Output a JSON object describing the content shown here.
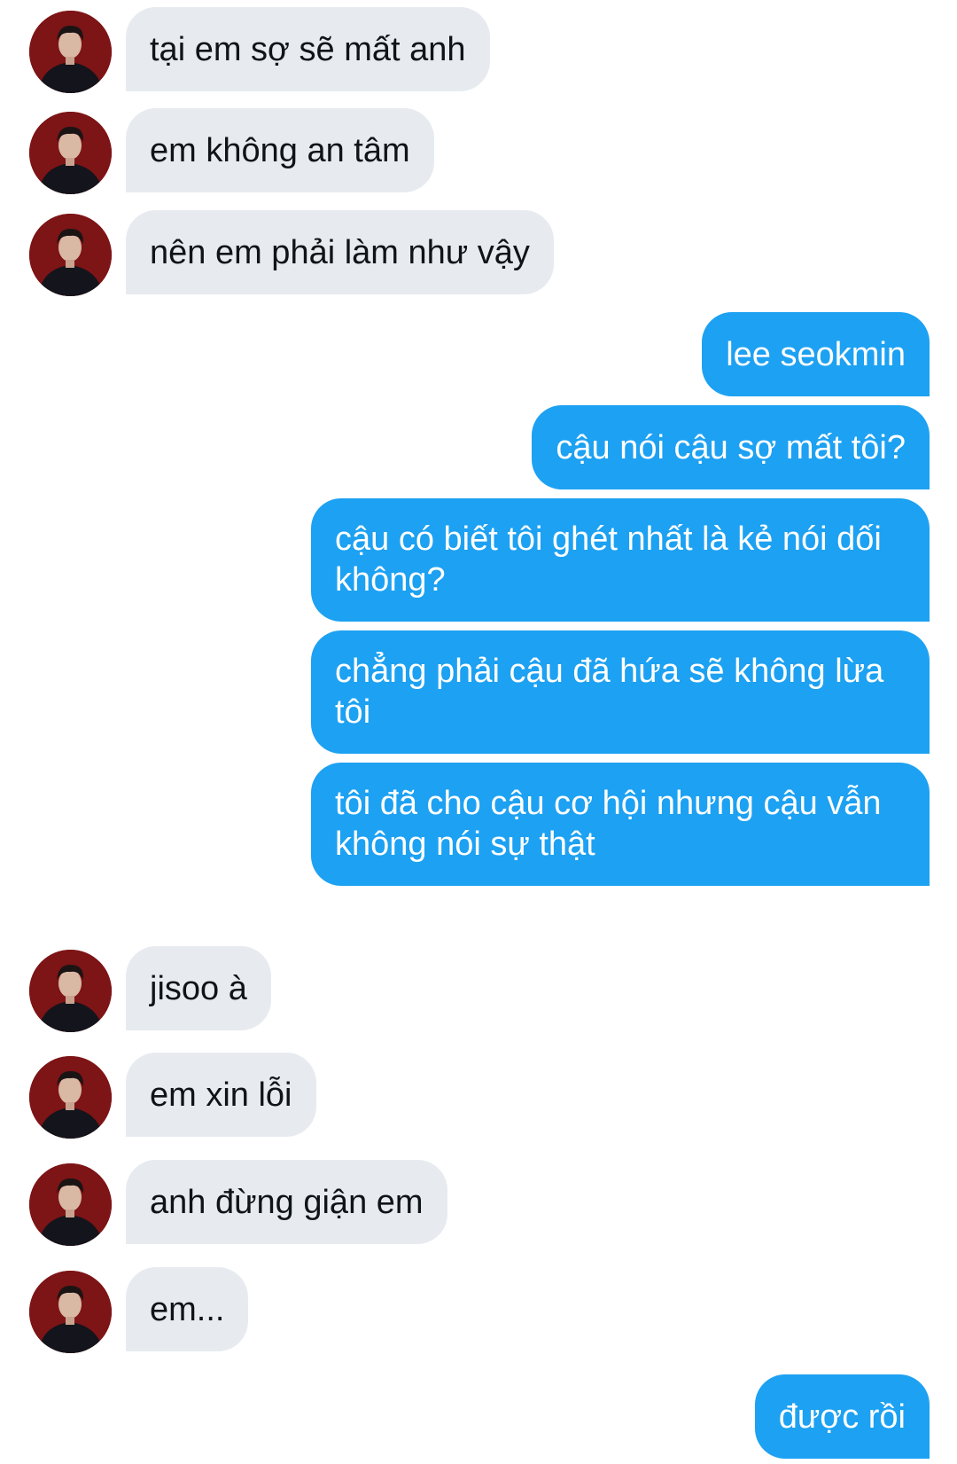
{
  "conversation": {
    "messages": [
      {
        "side": "in",
        "text": "tại em sợ sẽ mất anh",
        "avatar": "contact-avatar"
      },
      {
        "side": "in",
        "text": "em không an tâm",
        "avatar": "contact-avatar"
      },
      {
        "side": "in",
        "text": "nên em phải làm như vậy",
        "avatar": "contact-avatar"
      },
      {
        "side": "out",
        "text": "lee seokmin"
      },
      {
        "side": "out",
        "text": "cậu nói cậu sợ mất tôi?"
      },
      {
        "side": "out",
        "text": "cậu có biết tôi ghét nhất là kẻ nói dối không?"
      },
      {
        "side": "out",
        "text": "chẳng phải cậu đã hứa sẽ không lừa tôi"
      },
      {
        "side": "out",
        "text": "tôi đã cho cậu cơ hội nhưng cậu vẫn không nói sự thật"
      },
      {
        "side": "in",
        "text": "jisoo à",
        "avatar": "contact-avatar"
      },
      {
        "side": "in",
        "text": "em xin lỗi",
        "avatar": "contact-avatar"
      },
      {
        "side": "in",
        "text": "anh đừng giận em",
        "avatar": "contact-avatar"
      },
      {
        "side": "in",
        "text": "em...",
        "avatar": "contact-avatar"
      },
      {
        "side": "out",
        "text": "được rồi"
      }
    ]
  },
  "colors": {
    "incoming_bubble": "#e7ebf0",
    "outgoing_bubble": "#1da1f2",
    "incoming_text": "#0f1419",
    "outgoing_text": "#ffffff",
    "avatar_background": "#7d1416"
  }
}
